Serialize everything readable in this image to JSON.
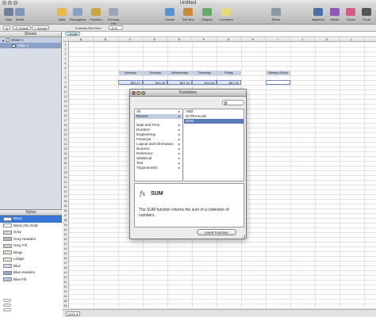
{
  "window": {
    "title": "Untitled"
  },
  "toolbar": {
    "left": [
      {
        "name": "view",
        "label": "View",
        "color": "#6d7f99"
      },
      {
        "name": "sheet",
        "label": "Sheet",
        "color": "#7f95b8"
      },
      {
        "name": "table",
        "label": "Table",
        "color": "#e9b84a"
      },
      {
        "name": "reorganize",
        "label": "Reorganize",
        "color": "#8aa0c4"
      },
      {
        "name": "function",
        "label": "Function",
        "color": "#c9a646"
      },
      {
        "name": "formula-list",
        "label": "Formula List",
        "color": "#9aa7b8"
      }
    ],
    "middle": [
      {
        "name": "charts",
        "label": "Charts",
        "color": "#5a8fd0"
      },
      {
        "name": "text-box",
        "label": "Text Box",
        "color": "#c98a3e"
      },
      {
        "name": "shapes",
        "label": "Shapes",
        "color": "#6aa86a"
      },
      {
        "name": "comment",
        "label": "Comment",
        "color": "#e8d87a"
      }
    ],
    "share": {
      "label": "Share",
      "color": "#8899aa"
    },
    "right": [
      {
        "name": "inspector",
        "label": "Inspector",
        "color": "#4a6fa5"
      },
      {
        "name": "media",
        "label": "Media",
        "color": "#8e5ab8"
      },
      {
        "name": "colors",
        "label": "Colors",
        "color": "#d75a8b"
      },
      {
        "name": "fonts",
        "label": "Fonts",
        "color": "#555555"
      }
    ]
  },
  "formatbar": {
    "fx_label": "fx",
    "cancel_label": "Cancel",
    "accept_label": "Accept",
    "text_size_label": "Formula Text Size:",
    "text_size_value": "10"
  },
  "sidebar": {
    "sheets_header": "Sheets",
    "sheet_name": "Sheet 1",
    "table_name": "Table 1",
    "styles_header": "Styles",
    "styles": [
      {
        "label": "Basic",
        "swatch": "#f4f4f4",
        "selected": true
      },
      {
        "label": "Basic (No Grid)",
        "swatch": "#ffffff"
      },
      {
        "label": "Gray",
        "swatch": "#d8d8d8"
      },
      {
        "label": "Gray Headers",
        "swatch": "#b8b8b8"
      },
      {
        "label": "Gray Fill",
        "swatch": "#cfcfcf"
      },
      {
        "label": "Beige",
        "swatch": "#eadfc8"
      },
      {
        "label": "Ledger",
        "swatch": "#e3ecd3"
      },
      {
        "label": "Blue",
        "swatch": "#cfdcf0"
      },
      {
        "label": "Blue Headers",
        "swatch": "#8ea8d8"
      },
      {
        "label": "Blue Fill",
        "swatch": "#b7c9ea"
      }
    ]
  },
  "formula": {
    "token": "=SUM"
  },
  "grid": {
    "columns": [
      "A",
      "B",
      "C",
      "D",
      "E",
      "F",
      "G",
      "H",
      "I",
      "J",
      "K",
      "L"
    ],
    "headers": [
      "Monday",
      "Tuesday",
      "Wednesday",
      "Thursday",
      "Friday"
    ],
    "values": [
      "$53.27",
      "$42.06",
      "$67.33",
      "$12.06",
      "$67.00"
    ],
    "extra_header": "Weekly Gross"
  },
  "dialog": {
    "title": "Functions",
    "categories": [
      {
        "label": "All",
        "chev": "▸"
      },
      {
        "label": "Recent",
        "chev": "▸",
        "selected": true
      },
      {
        "label": "",
        "gap": true
      },
      {
        "label": "Date and Time",
        "chev": "▸"
      },
      {
        "label": "Duration",
        "chev": "▸"
      },
      {
        "label": "Engineering",
        "chev": "▸"
      },
      {
        "label": "Financial",
        "chev": "▸"
      },
      {
        "label": "Logical and Information",
        "chev": "▸"
      },
      {
        "label": "Numeric",
        "chev": "▸"
      },
      {
        "label": "Reference",
        "chev": "▸"
      },
      {
        "label": "Statistical",
        "chev": "▸"
      },
      {
        "label": "Text",
        "chev": "▸"
      },
      {
        "label": "Trigonometric",
        "chev": "▸"
      }
    ],
    "functions": [
      {
        "label": "AND"
      },
      {
        "label": "DATEVALUE"
      },
      {
        "label": "SUM",
        "selected": true
      }
    ],
    "fx_symbol": "fx",
    "selected_name": "SUM",
    "description": "The SUM function returns the sum of a collection of numbers.",
    "insert_label": "Insert Function"
  },
  "statusbar": {
    "zoom": "100%"
  }
}
